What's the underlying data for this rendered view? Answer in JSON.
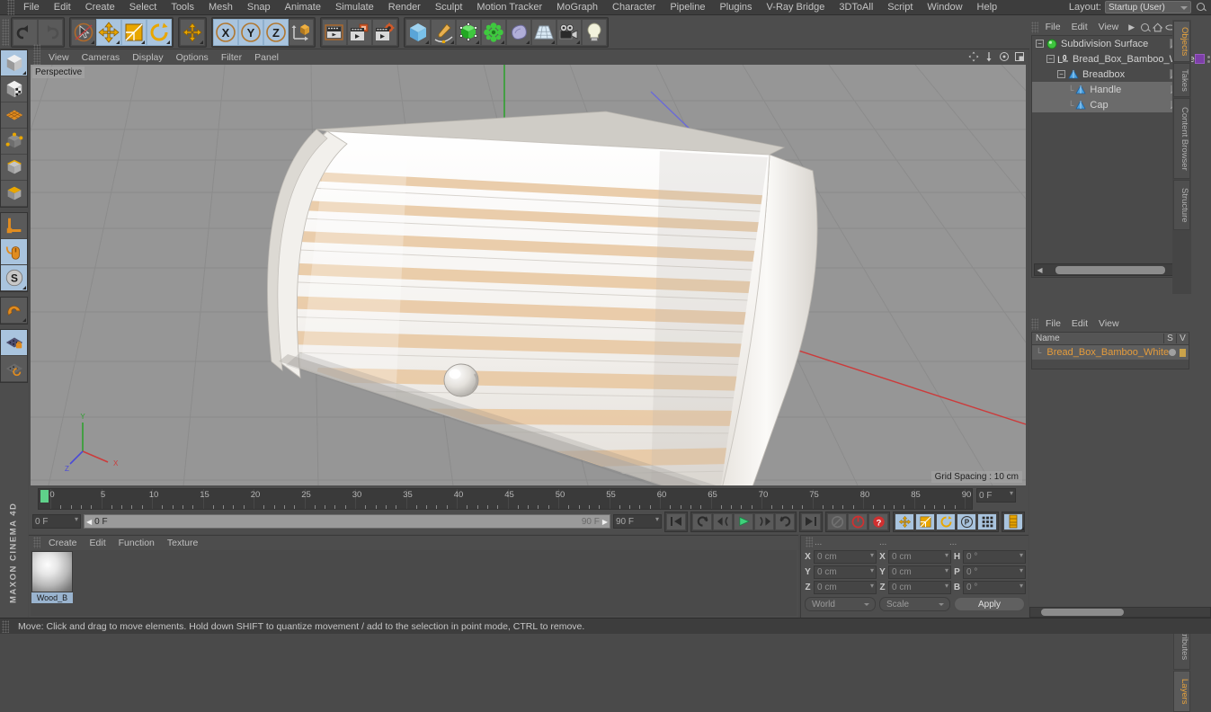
{
  "app": {
    "name": "MAXON CINEMA 4D",
    "brand_text": "MAXON CINEMA 4D"
  },
  "menubar": {
    "items": [
      "File",
      "Edit",
      "Create",
      "Select",
      "Tools",
      "Mesh",
      "Snap",
      "Animate",
      "Simulate",
      "Render",
      "Sculpt",
      "Motion Tracker",
      "MoGraph",
      "Character",
      "Pipeline",
      "Plugins",
      "V-Ray Bridge",
      "3DToAll",
      "Script",
      "Window",
      "Help"
    ],
    "layout_label": "Layout:",
    "layout_value": "Startup (User)",
    "search_icon": "magnify-icon"
  },
  "toolbar": {
    "groups": [
      {
        "name": "history",
        "buttons": [
          {
            "name": "undo-button",
            "icon": "undo-arrow-icon",
            "active": false
          },
          {
            "name": "redo-button",
            "icon": "redo-arrow-icon",
            "active": false,
            "disabled": true
          }
        ]
      },
      {
        "name": "transform-tools",
        "buttons": [
          {
            "name": "live-selection-tool",
            "icon": "cursor-circle-icon",
            "active": false
          },
          {
            "name": "move-tool",
            "icon": "move-arrows-icon",
            "active": true
          },
          {
            "name": "scale-tool",
            "icon": "scale-box-icon",
            "active": false
          },
          {
            "name": "rotate-tool",
            "icon": "rotate-circle-icon",
            "active": false
          }
        ]
      },
      {
        "name": "placement-tool",
        "buttons": [
          {
            "name": "place-tool",
            "icon": "move-arrows-icon",
            "active": false
          }
        ]
      },
      {
        "name": "axis-locks",
        "buttons": [
          {
            "name": "lock-x-axis",
            "icon": "x-axis-icon",
            "label": "X",
            "active": true
          },
          {
            "name": "lock-y-axis",
            "icon": "y-axis-icon",
            "label": "Y",
            "active": true
          },
          {
            "name": "lock-z-axis",
            "icon": "z-axis-icon",
            "label": "Z",
            "active": true
          },
          {
            "name": "world-object-coordinates",
            "icon": "world-axis-cube-icon",
            "active": false
          }
        ]
      },
      {
        "name": "render-tools",
        "buttons": [
          {
            "name": "render-view-button",
            "icon": "render-clapper-icon",
            "active": false
          },
          {
            "name": "render-to-picture-viewer-button",
            "icon": "render-picture-icon",
            "active": false
          },
          {
            "name": "render-settings-button",
            "icon": "render-settings-icon",
            "active": false
          }
        ]
      },
      {
        "name": "create-tools",
        "buttons": [
          {
            "name": "add-cube-button",
            "icon": "blue-cube-icon",
            "active": false
          },
          {
            "name": "add-spline-button",
            "icon": "pen-spline-icon",
            "active": false
          },
          {
            "name": "add-generator-button",
            "icon": "green-cube-icon",
            "active": false
          },
          {
            "name": "add-deformer-button",
            "icon": "green-atom-icon",
            "active": false
          },
          {
            "name": "add-scene-object-button",
            "icon": "environment-blob-icon",
            "active": false
          },
          {
            "name": "add-floor-button",
            "icon": "floor-grid-icon",
            "active": false
          },
          {
            "name": "add-camera-button",
            "icon": "camera-icon",
            "active": false
          },
          {
            "name": "add-light-button",
            "icon": "lightbulb-icon",
            "active": false
          }
        ]
      }
    ]
  },
  "left_palette": {
    "groups": [
      {
        "buttons": [
          {
            "name": "model-mode-button",
            "icon": "model-cube-icon",
            "active": true
          },
          {
            "name": "texture-mode-button",
            "icon": "texture-cube-icon",
            "active": false
          },
          {
            "name": "deformation-mode-button",
            "icon": "deform-grid-icon",
            "active": false
          },
          {
            "name": "points-mode-button",
            "icon": "points-cube-icon",
            "active": false
          },
          {
            "name": "edges-mode-button",
            "icon": "edges-cube-icon",
            "active": false
          },
          {
            "name": "polygons-mode-button",
            "icon": "polygons-cube-icon",
            "active": false
          }
        ]
      },
      {
        "buttons": [
          {
            "name": "enable-axis-modification-button",
            "icon": "axis-l-icon",
            "active": false
          },
          {
            "name": "viewport-solo-button",
            "icon": "mouse-icon",
            "active": true
          },
          {
            "name": "workplane-button",
            "icon": "s-circle-icon",
            "active": true
          }
        ]
      },
      {
        "buttons": [
          {
            "name": "snap-magnet-button",
            "icon": "magnet-icon",
            "active": false
          }
        ]
      },
      {
        "buttons": [
          {
            "name": "lock-workplane-button",
            "icon": "workplane-lock-icon",
            "active": true
          },
          {
            "name": "planar-workplane-button",
            "icon": "workplane-rotate-icon",
            "active": false
          }
        ]
      }
    ]
  },
  "viewport": {
    "menu": [
      "View",
      "Cameras",
      "Display",
      "Options",
      "Filter",
      "Panel"
    ],
    "camera_label": "Perspective",
    "grid_spacing": "Grid Spacing : 10 cm",
    "corner_icons": [
      "pan-icon",
      "dolly-icon",
      "orbit-icon",
      "maximize-icon"
    ],
    "axis_gizmo": {
      "x": "X",
      "y": "Y",
      "z": "Z"
    },
    "background_color": "#969696",
    "grid_line_color": "#8a8a8a",
    "model_name": "Bread box (bamboo, white)"
  },
  "timeline": {
    "start_frame": "0 F",
    "end_frame": "90 F",
    "current_frame": "0 F",
    "preview_min": "0 F",
    "preview_max": "90 F",
    "ruler_labels": [
      0,
      5,
      10,
      15,
      20,
      25,
      30,
      35,
      40,
      45,
      50,
      55,
      60,
      65,
      70,
      75,
      80,
      85,
      90
    ],
    "ruler_max": 90,
    "playhead_frame": 0,
    "transport": [
      {
        "name": "go-to-start-button",
        "icon": "skip-start-icon",
        "active": false
      },
      {
        "name": "play-backwards-loop-button",
        "icon": "loop-ccw-icon",
        "active": false
      },
      {
        "name": "previous-frame-button",
        "icon": "step-back-icon",
        "active": false
      },
      {
        "name": "play-button",
        "icon": "play-triangle-icon",
        "active": false
      },
      {
        "name": "next-frame-button",
        "icon": "step-forward-icon",
        "active": false
      },
      {
        "name": "play-forwards-loop-button",
        "icon": "loop-cw-icon",
        "active": false
      },
      {
        "name": "go-to-end-button",
        "icon": "skip-end-icon",
        "active": false
      }
    ],
    "record_group": [
      {
        "name": "record-active-objects-button",
        "icon": "record-circle-icon",
        "active": false
      },
      {
        "name": "autokeying-button",
        "icon": "autokey-circle-icon",
        "active": false
      },
      {
        "name": "keyframe-selection-button",
        "icon": "question-circle-icon",
        "active": false
      }
    ],
    "key_group": [
      {
        "name": "position-key-button",
        "icon": "move-arrows-icon",
        "active": true
      },
      {
        "name": "scale-key-button",
        "icon": "scale-box-icon",
        "active": true
      },
      {
        "name": "rotation-key-button",
        "icon": "rotate-circle-icon",
        "active": true
      },
      {
        "name": "parameter-key-button",
        "icon": "p-circle-icon",
        "active": true
      },
      {
        "name": "point-level-animation-button",
        "icon": "pla-dots-icon",
        "active": true
      }
    ],
    "extra_group": [
      {
        "name": "timeline-layout-button",
        "icon": "timeline-stack-icon",
        "active": true
      }
    ]
  },
  "material_manager": {
    "menu": [
      "Create",
      "Edit",
      "Function",
      "Texture"
    ],
    "materials": [
      {
        "name": "Wood_B",
        "selected": true,
        "preview": "sphere-preview"
      }
    ]
  },
  "coordinates": {
    "headers": [
      "...",
      "...",
      "..."
    ],
    "rows": [
      {
        "label_pos": "X",
        "value_pos": "0 cm",
        "label_size": "X",
        "value_size": "0 cm",
        "label_rot": "H",
        "value_rot": "0 °"
      },
      {
        "label_pos": "Y",
        "value_pos": "0 cm",
        "label_size": "Y",
        "value_size": "0 cm",
        "label_rot": "P",
        "value_rot": "0 °"
      },
      {
        "label_pos": "Z",
        "value_pos": "0 cm",
        "label_size": "Z",
        "value_size": "0 cm",
        "label_rot": "B",
        "value_rot": "0 °"
      }
    ],
    "space_select": "World",
    "mode_select": "Scale",
    "apply_label": "Apply"
  },
  "object_manager": {
    "menu": [
      "File",
      "Edit",
      "View"
    ],
    "menu_overflow_icon": "chevron-right-icon",
    "header_icons": [
      "magnify-icon",
      "home-icon",
      "ellipse-icon",
      "collapse-icon"
    ],
    "items": [
      {
        "name": "Subdivision Surface",
        "depth": 0,
        "icon": "subdivision-surface-icon",
        "expandable": true,
        "selected": false,
        "tag": "grey"
      },
      {
        "name": "Bread_Box_Bamboo_White",
        "depth": 1,
        "icon": "layer-zero-icon",
        "expandable": true,
        "selected": false,
        "tag": "purple"
      },
      {
        "name": "Breadbox",
        "depth": 2,
        "icon": "polygon-object-icon",
        "expandable": true,
        "selected": false,
        "tag": "grey"
      },
      {
        "name": "Handle",
        "depth": 3,
        "icon": "polygon-object-icon",
        "expandable": false,
        "selected": true,
        "tag": "grey"
      },
      {
        "name": "Cap",
        "depth": 3,
        "icon": "polygon-object-icon",
        "expandable": false,
        "selected": true,
        "tag": "grey"
      }
    ],
    "tabs": [
      "Objects",
      "Takes",
      "Content Browser",
      "Structure"
    ],
    "active_tab": "Objects"
  },
  "attribute_manager": {
    "menu": [
      "File",
      "Edit",
      "View"
    ],
    "columns": [
      "Name",
      "S",
      "V"
    ],
    "rows": [
      {
        "name": "Bread_Box_Bamboo_White",
        "swatch": "#7d3fa8",
        "selected": true
      }
    ],
    "tabs": [
      "Attributes",
      "Layers"
    ],
    "active_tab": "Layers"
  },
  "statusbar": {
    "message": "Move: Click and drag to move elements. Hold down SHIFT to quantize movement / add to the selection in point mode, CTRL to remove."
  },
  "colors": {
    "chrome": "#4d4d4d",
    "menu_bg": "#3d3d3d",
    "accent_active": "#a9c4de",
    "accent_orange": "#e8a33d",
    "viewport_bg": "#969696",
    "green_axis": "#2fa02f",
    "red_axis": "#cc3b3b",
    "playhead_green": "#5fd18a",
    "material_purple": "#7d3fa8"
  }
}
